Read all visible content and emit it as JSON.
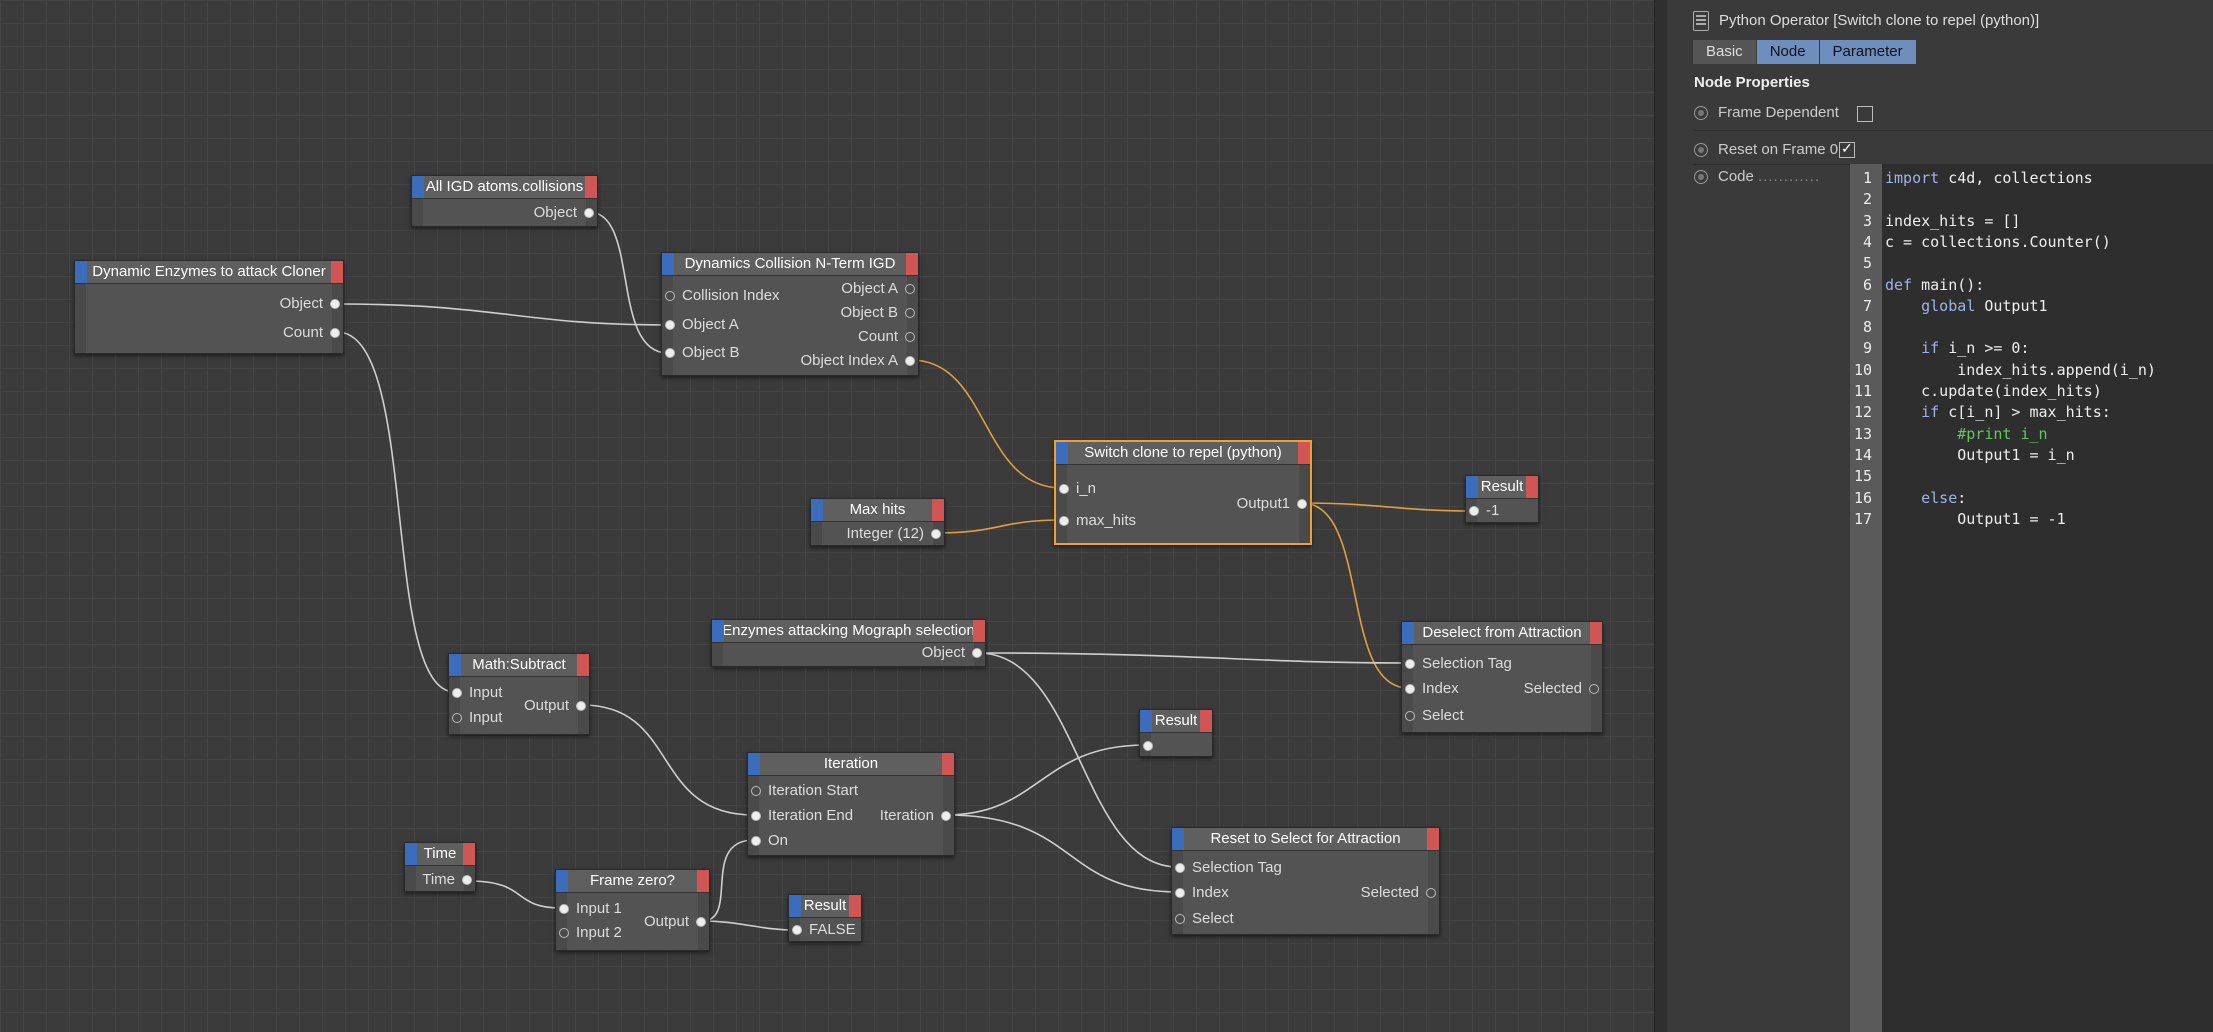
{
  "nodes": {
    "enzymes_cloner": {
      "title": "Dynamic Enzymes to attack Cloner",
      "out": [
        "Object",
        "Count"
      ]
    },
    "all_igd": {
      "title": "All IGD atoms.collisions",
      "out": [
        "Object"
      ]
    },
    "collision": {
      "title": "Dynamics Collision N-Term IGD",
      "in": [
        "Collision Index",
        "Object A",
        "Object B"
      ],
      "out": [
        "Object A",
        "Object B",
        "Count",
        "Object Index A"
      ]
    },
    "switch_clone": {
      "title": "Switch clone to repel (python)",
      "in": [
        "i_n",
        "max_hits"
      ],
      "out": [
        "Output1"
      ]
    },
    "max_hits": {
      "title": "Max hits",
      "out": [
        "Integer (12)"
      ]
    },
    "result1": {
      "title": "Result",
      "out": [
        "-1"
      ]
    },
    "enzymes_sel": {
      "title": "Enzymes attacking Mograph selection",
      "out": [
        "Object"
      ]
    },
    "deselect": {
      "title": "Deselect from Attraction",
      "in": [
        "Selection Tag",
        "Index",
        "Select"
      ],
      "out": [
        "Selected"
      ]
    },
    "math_sub": {
      "title": "Math:Subtract",
      "in": [
        "Input",
        "Input"
      ],
      "out": [
        "Output"
      ]
    },
    "result2": {
      "title": "Result"
    },
    "iteration": {
      "title": "Iteration",
      "in": [
        "Iteration Start",
        "Iteration End",
        "On"
      ],
      "out": [
        "Iteration"
      ]
    },
    "time": {
      "title": "Time",
      "out": [
        "Time"
      ]
    },
    "frame_zero": {
      "title": "Frame zero?",
      "in": [
        "Input 1",
        "Input 2"
      ],
      "out": [
        "Output"
      ]
    },
    "result3": {
      "title": "Result",
      "out": [
        "FALSE"
      ]
    },
    "reset_sel": {
      "title": "Reset to Select for Attraction",
      "in": [
        "Selection Tag",
        "Index",
        "Select"
      ],
      "out": [
        "Selected"
      ]
    }
  },
  "panel": {
    "title": "Python Operator [Switch clone to repel (python)]",
    "tabs": [
      "Basic",
      "Node",
      "Parameter"
    ],
    "section": "Node Properties",
    "props": {
      "frame_dependent": "Frame Dependent",
      "reset_frame0": "Reset on Frame 0",
      "code": "Code",
      "code_dots": "............"
    },
    "code_lines": [
      "import c4d, collections",
      "",
      "index_hits = []",
      "c = collections.Counter()",
      "",
      "def main():",
      "    global Output1",
      "",
      "    if i_n >= 0:",
      "        index_hits.append(i_n)",
      "    c.update(index_hits)",
      "    if c[i_n] > max_hits:",
      "        #print i_n",
      "        Output1 = i_n",
      "",
      "    else:",
      "        Output1 = -1"
    ]
  }
}
